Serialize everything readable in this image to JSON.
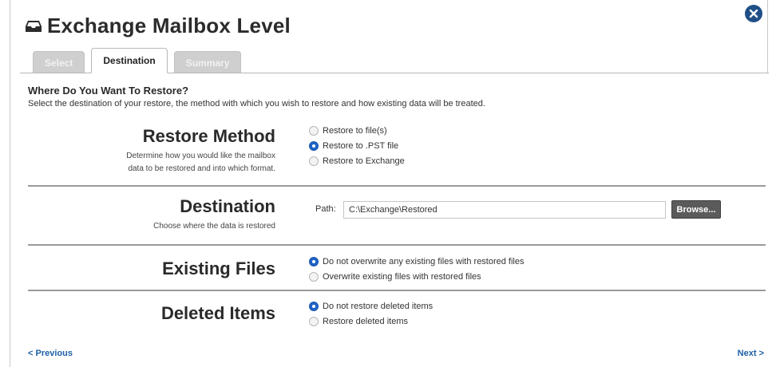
{
  "window": {
    "title": "Exchange Mailbox Level",
    "title_icon": "inbox-tray-icon",
    "close_icon": "close-icon"
  },
  "tabs": [
    {
      "label": "Select",
      "active": false
    },
    {
      "label": "Destination",
      "active": true
    },
    {
      "label": "Summary",
      "active": false
    }
  ],
  "page": {
    "heading": "Where Do You Want To Restore?",
    "subheading": "Select the destination of your restore, the method with which you wish to restore and how existing data will be treated."
  },
  "restore_method": {
    "title": "Restore Method",
    "description_line1": "Determine how you would like the mailbox",
    "description_line2": "data to be restored and into which format.",
    "options": [
      {
        "label": "Restore to file(s)",
        "checked": false
      },
      {
        "label": "Restore to .PST file",
        "checked": true
      },
      {
        "label": "Restore to Exchange",
        "checked": false
      }
    ]
  },
  "destination": {
    "title": "Destination",
    "description": "Choose where the data is restored",
    "path_label": "Path:",
    "path_value": "C:\\Exchange\\Restored",
    "browse_label": "Browse..."
  },
  "existing_files": {
    "title": "Existing Files",
    "options": [
      {
        "label": "Do not overwrite any existing files with restored files",
        "checked": true
      },
      {
        "label": "Overwrite existing files with restored files",
        "checked": false
      }
    ]
  },
  "deleted_items": {
    "title": "Deleted Items",
    "options": [
      {
        "label": "Do not restore deleted items",
        "checked": true
      },
      {
        "label": "Restore deleted items",
        "checked": false
      }
    ]
  },
  "nav": {
    "previous_label": "< Previous",
    "next_label": "Next >"
  },
  "colors": {
    "accent": "#1f63c7",
    "link": "#1f5fa8",
    "close_button": "#1f4f86"
  }
}
